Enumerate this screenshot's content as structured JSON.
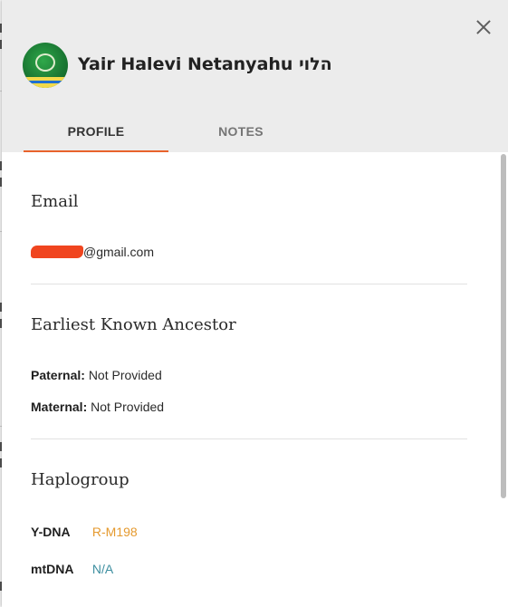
{
  "profile": {
    "name": "Yair Halevi Netanyahu הלוי",
    "avatar_icon": "community-emblem-icon"
  },
  "tabs": [
    {
      "label": "PROFILE",
      "active": true
    },
    {
      "label": "NOTES",
      "active": false
    }
  ],
  "colors": {
    "accent": "#e8632c",
    "ydna_value": "#e59a2f",
    "mtdna_value": "#3e8fa0",
    "redaction": "#f0451f"
  },
  "email": {
    "heading": "Email",
    "domain": "@gmail.com"
  },
  "ancestor": {
    "heading": "Earliest Known Ancestor",
    "paternal_label": "Paternal:",
    "paternal_value": "Not Provided",
    "maternal_label": "Maternal:",
    "maternal_value": "Not Provided"
  },
  "haplogroup": {
    "heading": "Haplogroup",
    "ydna_label": "Y-DNA",
    "ydna_value": "R-M198",
    "mtdna_label": "mtDNA",
    "mtdna_value": "N/A"
  }
}
